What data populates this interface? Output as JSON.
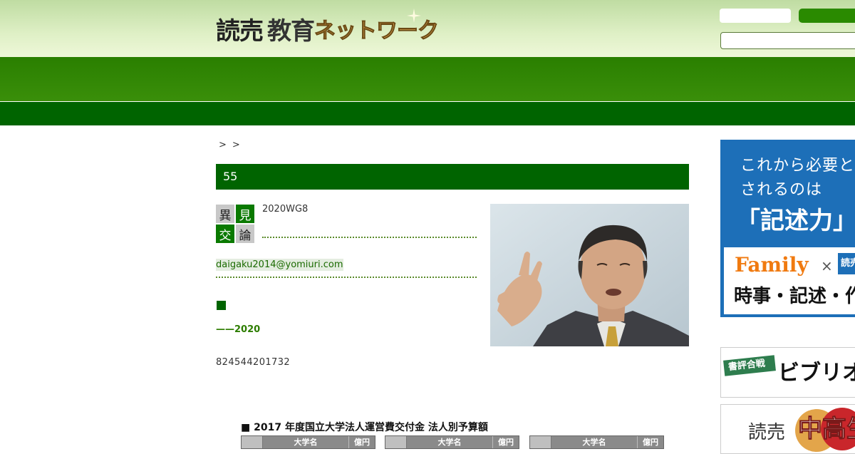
{
  "header": {
    "logo_part1": "読売",
    "logo_part2": "教育",
    "logo_part3": "ネットワーク"
  },
  "breadcrumb": {
    "sep1": ">",
    "sep2": ">"
  },
  "article": {
    "title": "55",
    "badge": [
      "異",
      "見",
      "交",
      "論"
    ],
    "series_text": "2020WG8",
    "email": "daigaku2014@yomiuri.com",
    "square_mark": "■",
    "subhead": "——2020",
    "numbers": "824544201732"
  },
  "budget": {
    "title": "■ 2017 年度国立大学法人運営費交付金 法人別予算額",
    "col_name": "大学名",
    "col_amount": "億円"
  },
  "ads": {
    "main_line1": "これから必要と",
    "main_line2": "されるのは",
    "main_kijutsu": "「記述力」",
    "main_family": "Family",
    "main_x": "×",
    "main_yomiuri": "読売",
    "main_bottom": "時事・記述・作",
    "bibli_tag": "書評合戦",
    "bibli_text": "ビブリオ",
    "chuko_yomiuri": "読売",
    "chuko_text": "中高生"
  },
  "colors": {
    "primary_green": "#006400",
    "nav_green": "#2a7f00",
    "ad_blue": "#1d6fb8",
    "accent_orange": "#f07a10"
  }
}
